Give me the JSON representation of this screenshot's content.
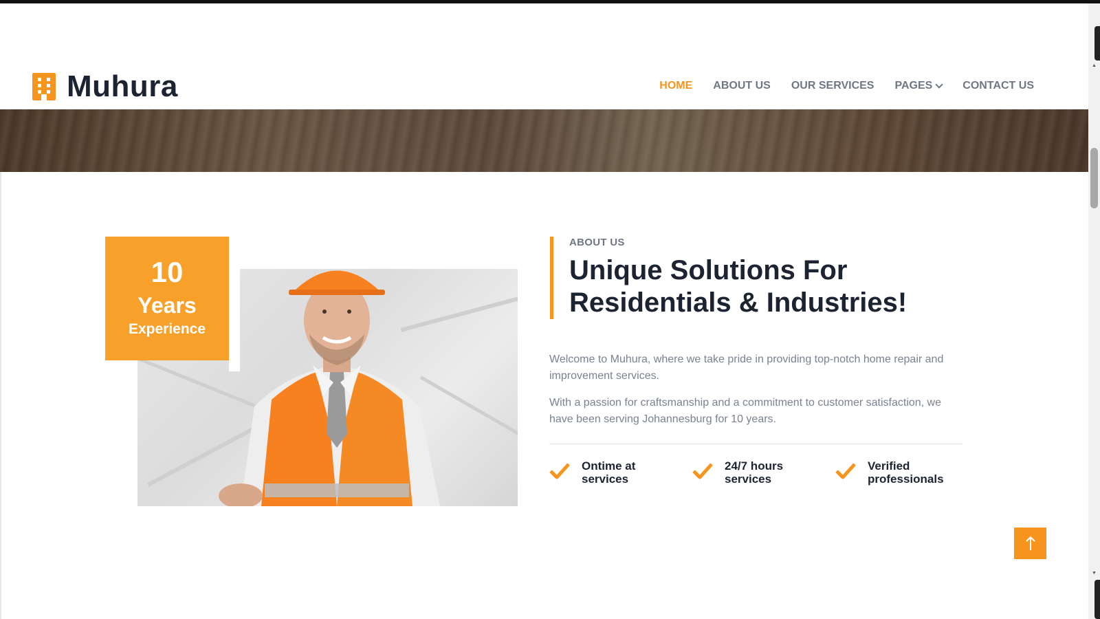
{
  "brand": {
    "name": "Muhura",
    "accent": "#f7941d",
    "dark": "#1c2331"
  },
  "nav": {
    "items": [
      {
        "label": "HOME",
        "active": true
      },
      {
        "label": "ABOUT US",
        "active": false
      },
      {
        "label": "OUR SERVICES",
        "active": false
      },
      {
        "label": "PAGES",
        "active": false,
        "dropdown": true
      },
      {
        "label": "CONTACT US",
        "active": false
      }
    ]
  },
  "about": {
    "badge": {
      "number": "10",
      "unit": "Years",
      "label": "Experience"
    },
    "eyebrow": "ABOUT US",
    "heading_line1": "Unique Solutions For",
    "heading_line2": "Residentials & Industries!",
    "paragraph1": "Welcome to Muhura, where we take pride in providing top-notch home repair and improvement services.",
    "paragraph2": "With a passion for craftsmanship and a commitment to customer satisfaction, we have been serving Johannesburg for 10 years.",
    "features": [
      {
        "label": "Ontime at services",
        "icon": "check-icon"
      },
      {
        "label": "24/7 hours services",
        "icon": "check-icon"
      },
      {
        "label": "Verified professionals",
        "icon": "check-icon"
      }
    ]
  },
  "back_to_top": {
    "icon": "arrow-up-icon"
  }
}
